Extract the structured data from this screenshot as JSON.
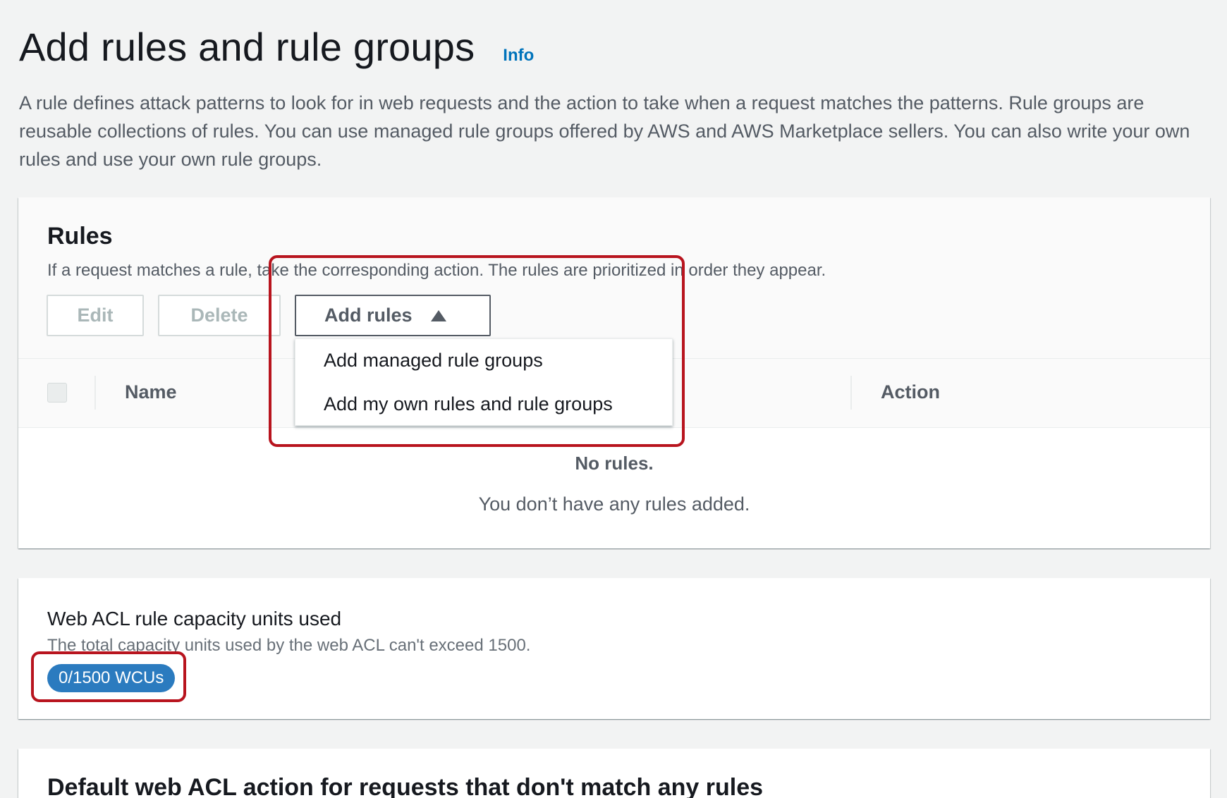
{
  "header": {
    "title": "Add rules and rule groups",
    "info_label": "Info",
    "description": "A rule defines attack patterns to look for in web requests and the action to take when a request matches the patterns. Rule groups are reusable collections of rules. You can use managed rule groups offered by AWS and AWS Marketplace sellers. You can also write your own rules and use your own rule groups."
  },
  "rules": {
    "title": "Rules",
    "description": "If a request matches a rule, take the corresponding action. The rules are prioritized in order they appear.",
    "edit_label": "Edit",
    "delete_label": "Delete",
    "add_rules_label": "Add rules",
    "add_rules_menu": [
      "Add managed rule groups",
      "Add my own rules and rule groups"
    ],
    "columns": [
      "Name",
      "Action"
    ],
    "empty_title": "No rules.",
    "empty_desc": "You don’t have any rules added."
  },
  "capacity": {
    "title": "Web ACL rule capacity units used",
    "description": "The total capacity units used by the web ACL can't exceed 1500.",
    "badge": "0/1500 WCUs"
  },
  "default_action": {
    "title": "Default web ACL action for requests that don't match any rules"
  },
  "colors": {
    "link": "#0073bb",
    "badge": "#2b7bbf",
    "highlight": "#b8141e"
  },
  "icons": {
    "add_rules_caret": "caret-up-icon"
  }
}
